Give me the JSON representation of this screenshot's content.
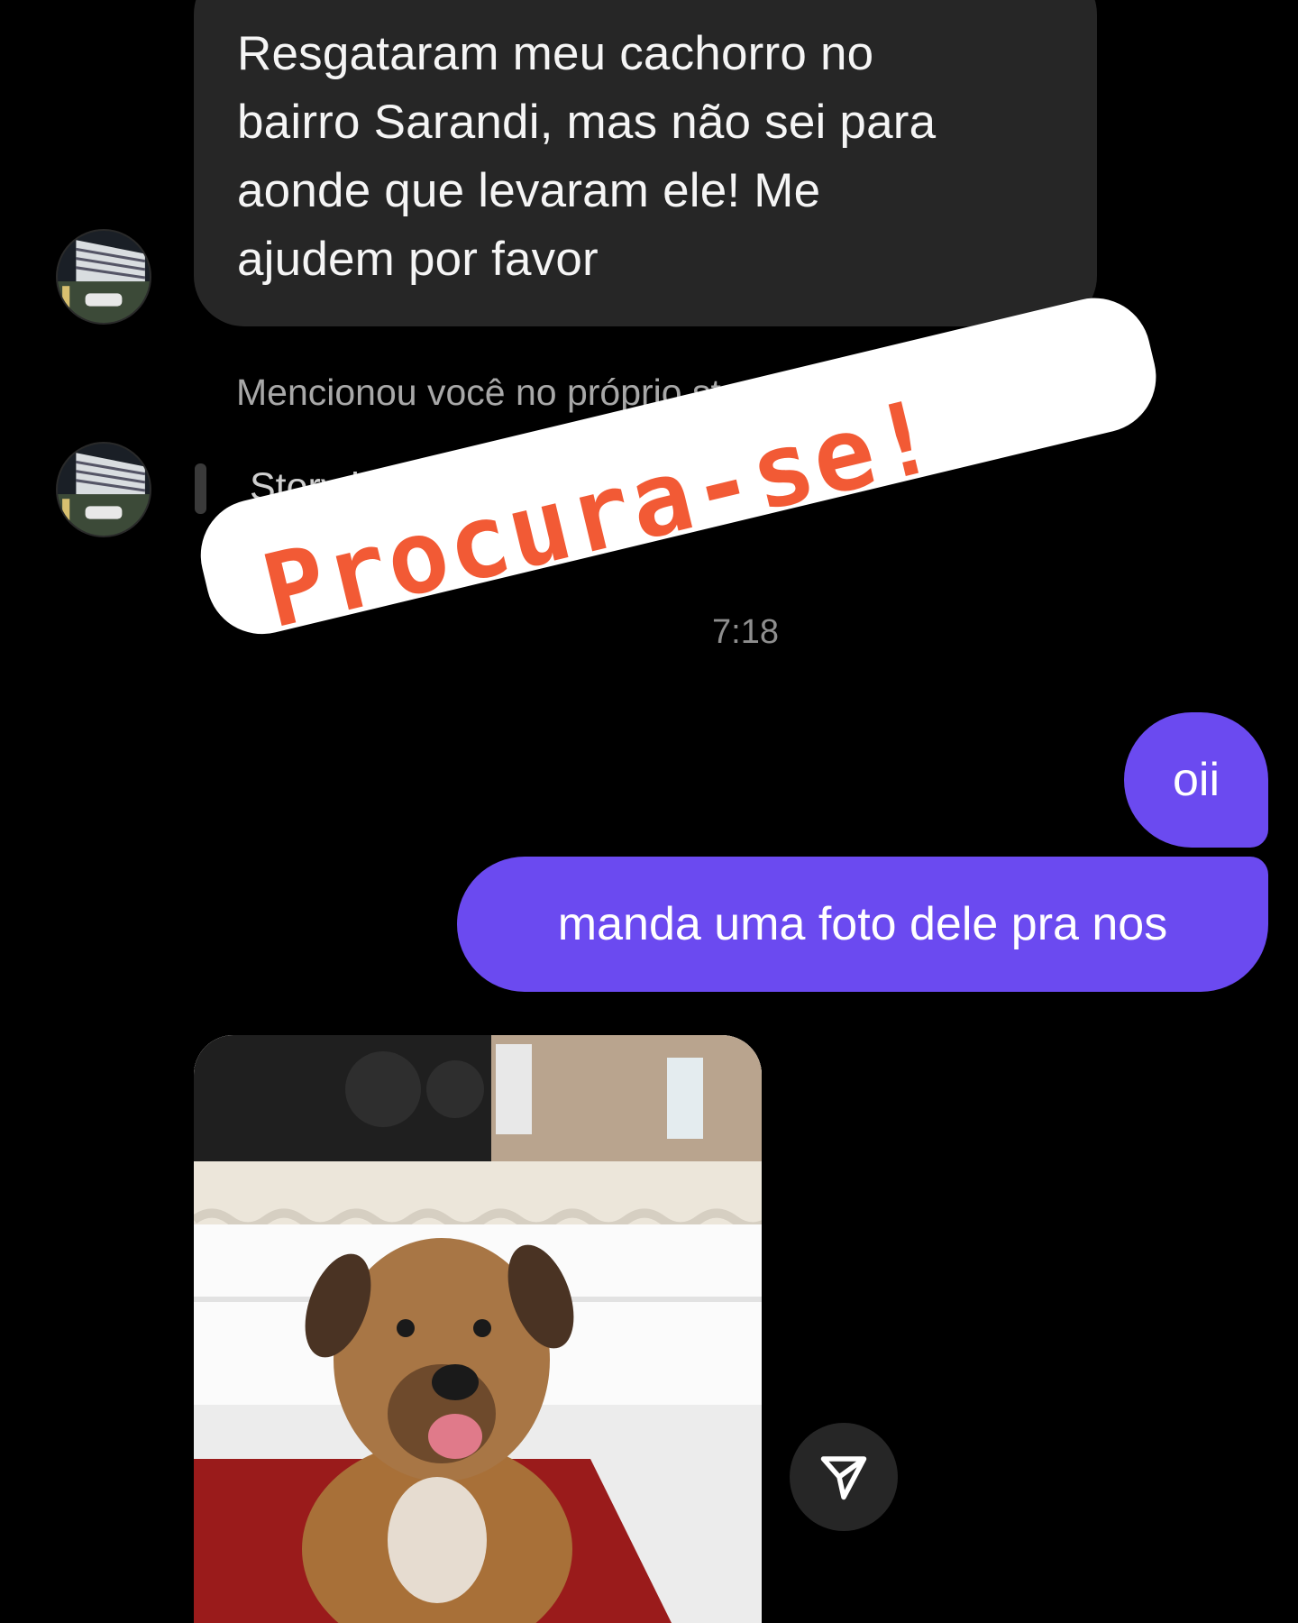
{
  "incoming_message": {
    "lines": [
      "Resgataram meu cachorro no",
      "bairro Sarandi, mas não sei para",
      "aonde que levaram ele! Me",
      "ajudem por favor"
    ]
  },
  "mention": {
    "label": "Mencionou você no próprio story",
    "story_status": "Story indisponível"
  },
  "timestamp_partial": "7:18",
  "sticker": {
    "text": "Procura-se!",
    "text_color": "#f25a35",
    "background": "#ffffff"
  },
  "outgoing_messages": [
    "oii",
    "manda uma foto dele pra nos"
  ],
  "photo": {
    "subject": "dog-photo"
  },
  "colors": {
    "outgoing_bubble": "#6b4af0",
    "incoming_bubble": "#262626",
    "background": "#000000"
  },
  "icons": {
    "share": "paper-plane-icon"
  }
}
